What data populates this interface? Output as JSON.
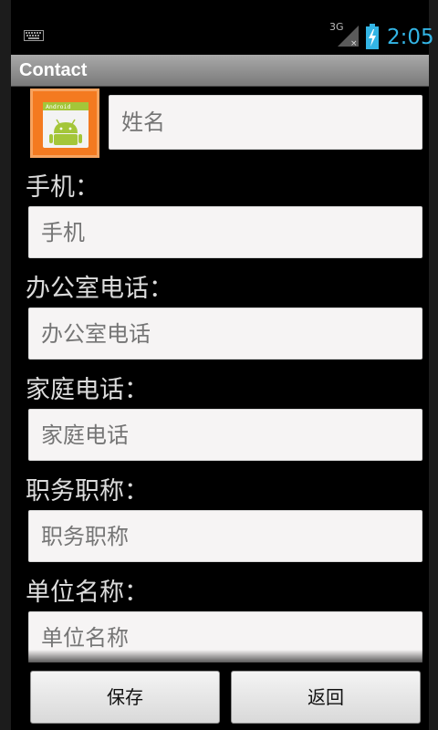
{
  "status_bar": {
    "network": "3G",
    "time": "2:05",
    "icons": [
      "keyboard-icon",
      "signal-icon",
      "battery-charging-icon"
    ]
  },
  "app": {
    "title": "Contact"
  },
  "form": {
    "name": {
      "placeholder": "姓名"
    },
    "mobile": {
      "label": "手机：",
      "placeholder": "手机"
    },
    "office_phone": {
      "label": "办公室电话：",
      "placeholder": "办公室电话"
    },
    "home_phone": {
      "label": "家庭电话：",
      "placeholder": "家庭电话"
    },
    "job_title": {
      "label": "职务职称：",
      "placeholder": "职务职称"
    },
    "company": {
      "label": "单位名称：",
      "placeholder": "单位名称"
    }
  },
  "buttons": {
    "save": "保存",
    "back": "返回"
  },
  "colors": {
    "accent": "#33b5e5",
    "avatar_bg": "#f47a20",
    "android_green": "#a4c639"
  }
}
